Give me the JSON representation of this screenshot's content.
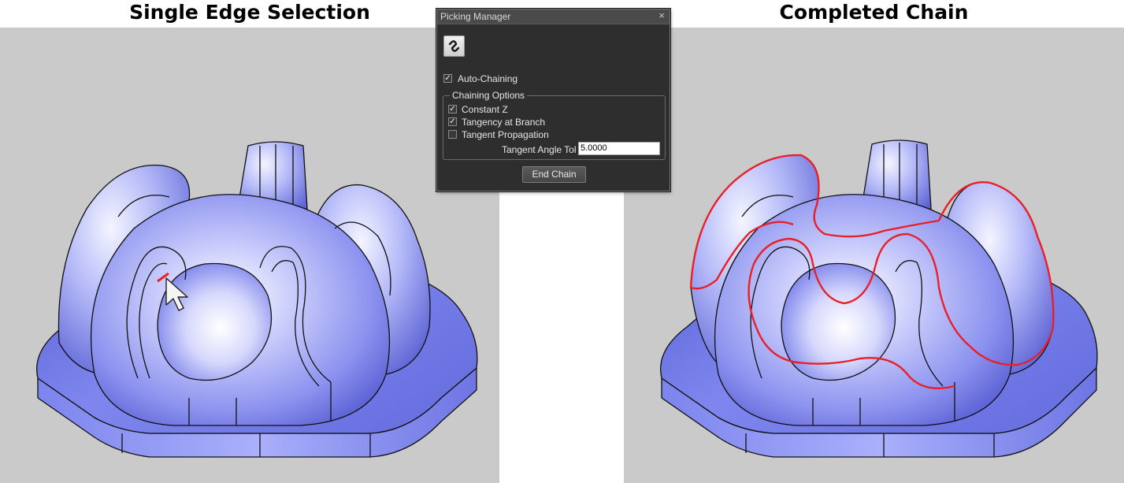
{
  "captions": {
    "left": "Single Edge Selection",
    "right": "Completed Chain"
  },
  "dialog": {
    "title": "Picking Manager",
    "close_glyph": "×",
    "tool_icon": "chain-link-icon",
    "auto_chaining": {
      "label": "Auto-Chaining",
      "checked": true
    },
    "chaining_options": {
      "legend": "Chaining Options",
      "constant_z": {
        "label": "Constant Z",
        "checked": true
      },
      "tangency_at_branch": {
        "label": "Tangency at Branch",
        "checked": true
      },
      "tangent_propagation": {
        "label": "Tangent Propagation",
        "checked": false
      },
      "tangent_angle_tol": {
        "label": "Tangent Angle Tol",
        "value": "5.0000"
      }
    },
    "end_chain_label": "End Chain"
  },
  "colors": {
    "viewport_bg": "#cacaca",
    "model_blue": "#6f78e6",
    "selection_red": "#e8202a"
  }
}
